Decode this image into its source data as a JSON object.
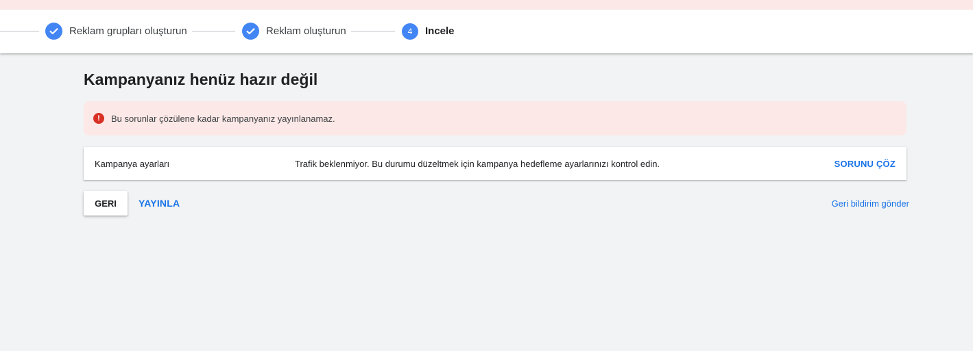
{
  "stepper": {
    "steps": [
      {
        "label": "Reklam grupları oluşturun",
        "state": "done"
      },
      {
        "label": "Reklam oluşturun",
        "state": "done"
      },
      {
        "number": "4",
        "label": "Incele",
        "state": "active"
      }
    ]
  },
  "page": {
    "title": "Kampanyanız henüz hazır değil"
  },
  "error_banner": {
    "icon": "error-icon",
    "icon_glyph": "!",
    "message": "Bu sorunlar çözülene kadar kampanyanız yayınlanamaz."
  },
  "issues": [
    {
      "category": "Kampanya ayarları",
      "message": "Trafik beklenmiyor. Bu durumu düzeltmek için kampanya hedefleme ayarlarınızı kontrol edin.",
      "action": "SORUNU ÇÖZ"
    }
  ],
  "actions": {
    "back_label": "GERI",
    "publish_label": "YAYINLA",
    "feedback_label": "Geri bildirim gönder"
  },
  "colors": {
    "accent": "#1a73e8",
    "step_blue": "#4285f4",
    "error_red": "#d93025",
    "error_bg": "#fce8e6",
    "page_bg": "#f1f3f4"
  }
}
